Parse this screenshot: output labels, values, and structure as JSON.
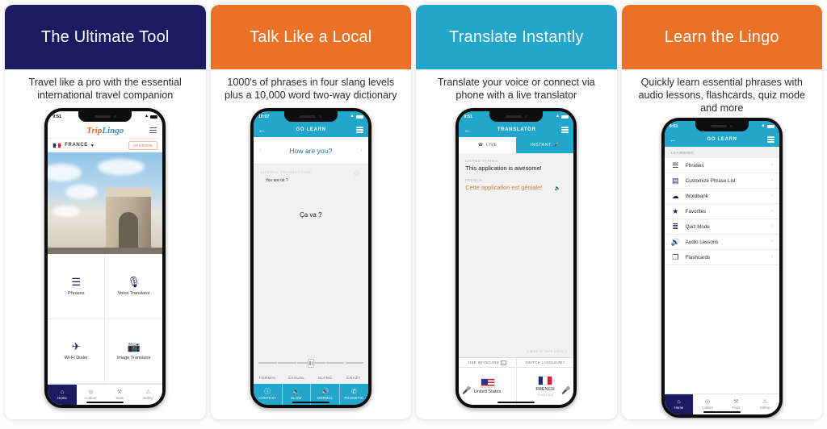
{
  "cards": [
    {
      "title": "The Ultimate Tool",
      "header_color": "#1b1b62",
      "subtitle": "Travel like a pro with the essential international travel companion",
      "phone": {
        "time": "9:51",
        "wifi_icon": "wifi-icon",
        "battery_icon": "battery-icon",
        "logo_part1": "Trip",
        "logo_part2": "Lingo",
        "menu_icon": "hamburger-menu-icon",
        "flag_icon": "france-flag-icon",
        "country": "FRANCE",
        "country_caret": "▾",
        "upgrade_label": "UPGRADE",
        "hero_icon": "arc-de-triomphe-photo",
        "grid": [
          {
            "label": "Phrases",
            "icon": "phrases-icon",
            "glyph": "☰"
          },
          {
            "label": "Voice Translator",
            "icon": "microphone-icon",
            "glyph": "🎙"
          },
          {
            "label": "Wi-Fi Dialer",
            "icon": "wifi-dialer-icon",
            "glyph": "✈"
          },
          {
            "label": "Image Translator",
            "icon": "camera-icon",
            "glyph": "📷"
          }
        ],
        "tabs": [
          {
            "label": "Home",
            "icon": "home-icon",
            "glyph": "⌂",
            "active": true
          },
          {
            "label": "Culture",
            "icon": "globe-icon",
            "glyph": "◎",
            "active": false
          },
          {
            "label": "Tools",
            "icon": "tools-icon",
            "glyph": "⚒",
            "active": false
          },
          {
            "label": "Safety",
            "icon": "warning-icon",
            "glyph": "⚠",
            "active": false
          }
        ]
      }
    },
    {
      "title": "Talk Like a Local",
      "header_color": "#ea7128",
      "subtitle": "1000's of phrases in four slang levels plus a 10,000 word two-way dictionary",
      "phone": {
        "time": "10:07",
        "nav_title": "GO LEARN",
        "back_icon": "back-arrow-icon",
        "menu_icon": "hamburger-menu-icon",
        "prev_arrow": "‹",
        "next_arrow": "›",
        "phrase": "How are you?",
        "literal_label": "LITERAL TRANSLATION",
        "literal_text": "You are ok ?",
        "star_icon": "favorite-star-icon",
        "target_text": "Ça va ?",
        "levels": [
          "FORMAL",
          "CASUAL",
          "SLANG",
          "CRAZY"
        ],
        "bottom_actions": [
          {
            "label": "CONTEXT",
            "icon": "info-icon",
            "glyph": "i"
          },
          {
            "label": "SLOW",
            "icon": "speaker-slow-icon",
            "glyph": "🔉"
          },
          {
            "label": "NORMAL",
            "icon": "speaker-normal-icon",
            "glyph": "🔊"
          },
          {
            "label": "PHONETIC",
            "icon": "phonetic-icon",
            "glyph": "🗣"
          }
        ]
      }
    },
    {
      "title": "Translate Instantly",
      "header_color": "#23a6cc",
      "subtitle": "Translate your voice or connect via phone with a live translator",
      "phone": {
        "time": "9:51",
        "nav_title": "TRANSLATOR",
        "back_icon": "back-arrow-icon",
        "menu_icon": "hamburger-menu-icon",
        "tab_live": "LIVE",
        "tab_live_icon": "phone-call-icon",
        "tab_instant": "INSTANT",
        "tab_instant_icon": "microphone-icon",
        "source_lang": "UNITED STATES",
        "source_text": "This application is awesome!",
        "target_lang": "FRENCH",
        "target_text": "Cette application est géniale!",
        "speaker_icon": "speaker-icon",
        "data_used": "3 MINS OF DATA USED",
        "info_icon": "info-circle-icon",
        "use_keyboard": "USE KEYBOARD",
        "keyboard_icon": "keyboard-icon",
        "switch_language": "SWITCH LANGUAGE?",
        "left_flag_icon": "us-flag-icon",
        "left_country": "United States",
        "right_flag_icon": "france-flag-icon",
        "right_country": "FRENCH",
        "right_country_native": "FRANÇAIS",
        "mic_left_icon": "microphone-icon",
        "mic_right_icon": "microphone-icon"
      }
    },
    {
      "title": "Learn the Lingo",
      "header_color": "#ea7128",
      "subtitle": "Quickly learn essential phrases with audio lessons, flashcards, quiz mode and more",
      "phone": {
        "time": "9:51",
        "nav_title": "GO LEARN",
        "back_icon": "back-arrow-icon",
        "menu_icon": "hamburger-menu-icon",
        "section_label": "LEARNING",
        "rows": [
          {
            "label": "Phrases",
            "icon": "phrases-icon",
            "glyph": "☰",
            "chevron": "›"
          },
          {
            "label": "Customize Phrase List",
            "icon": "customize-list-icon",
            "glyph": "▤",
            "chevron": "›"
          },
          {
            "label": "Wordbank",
            "icon": "wordbank-icon",
            "glyph": "☁",
            "chevron": "›"
          },
          {
            "label": "Favorites",
            "icon": "star-icon",
            "glyph": "★",
            "chevron": "›"
          },
          {
            "label": "Quiz Mode",
            "icon": "quiz-list-icon",
            "glyph": "≣",
            "chevron": "›"
          },
          {
            "label": "Audio Lessons",
            "icon": "speaker-icon",
            "glyph": "🔊",
            "chevron": "›"
          },
          {
            "label": "Flashcards",
            "icon": "flashcards-icon",
            "glyph": "❐",
            "chevron": "›"
          }
        ],
        "tabs": [
          {
            "label": "Home",
            "icon": "home-icon",
            "glyph": "⌂",
            "active": true
          },
          {
            "label": "Culture",
            "icon": "globe-icon",
            "glyph": "◎",
            "active": false
          },
          {
            "label": "Tools",
            "icon": "tools-icon",
            "glyph": "⚒",
            "active": false
          },
          {
            "label": "Safety",
            "icon": "warning-icon",
            "glyph": "⚠",
            "active": false
          }
        ]
      }
    }
  ]
}
